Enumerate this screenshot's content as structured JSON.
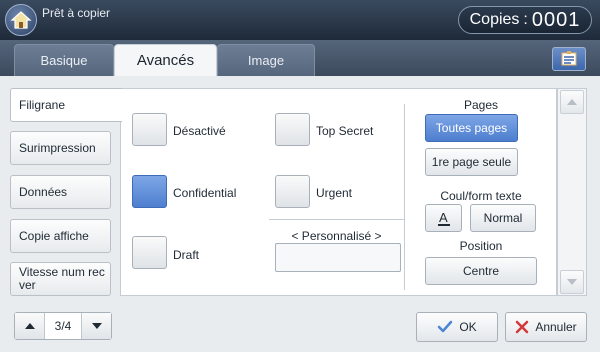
{
  "header": {
    "title": "Prêt à copier",
    "copies_label": "Copies",
    "copies_colon": ":",
    "copies_value": "0001"
  },
  "tabs": [
    {
      "label": "Basique"
    },
    {
      "label": "Avancés",
      "active": true
    },
    {
      "label": "Image"
    }
  ],
  "sidebar": {
    "items": [
      {
        "label": "Filigrane",
        "active": true
      },
      {
        "label": "Surimpression"
      },
      {
        "label": "Données"
      },
      {
        "label": "Copie affiche"
      },
      {
        "label": "Vitesse num rec ver"
      }
    ]
  },
  "watermark": {
    "options": [
      {
        "label": "Désactivé",
        "checked": false
      },
      {
        "label": "Top Secret",
        "checked": false
      },
      {
        "label": "Confidential",
        "checked": true
      },
      {
        "label": "Urgent",
        "checked": false
      },
      {
        "label": "Draft",
        "checked": false
      }
    ],
    "custom_label": "< Personnalisé >",
    "custom_value": ""
  },
  "pages": {
    "label": "Pages",
    "options": [
      "Toutes pages",
      "1re page seule"
    ],
    "selected": "Toutes pages"
  },
  "text_style": {
    "label": "Coul/form texte",
    "font_size": "Normal"
  },
  "position": {
    "label": "Position",
    "value": "Centre"
  },
  "pager": {
    "text": "3/4"
  },
  "actions": {
    "ok": "OK",
    "cancel": "Annuler"
  },
  "colors": {
    "accent": "#5a87d3",
    "header_bg": "#2a3748",
    "ok_check": "#4b86d6",
    "cancel_x": "#d23a3a"
  }
}
